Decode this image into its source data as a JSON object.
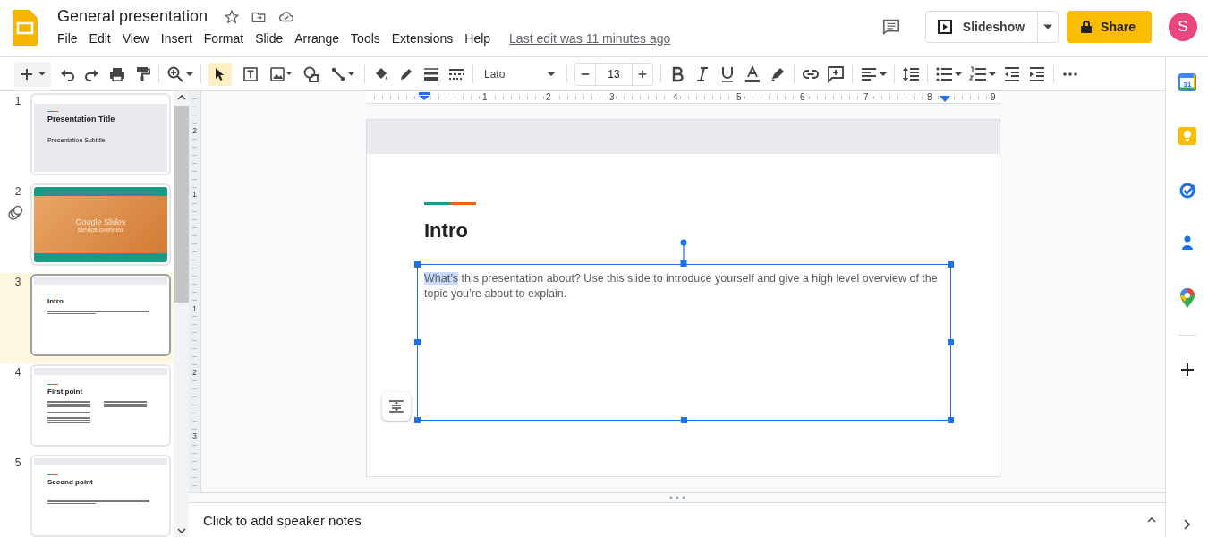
{
  "document": {
    "title": "General presentation",
    "last_edit": "Last edit was 11 minutes ago"
  },
  "menu": [
    "File",
    "Edit",
    "View",
    "Insert",
    "Format",
    "Slide",
    "Arrange",
    "Tools",
    "Extensions",
    "Help"
  ],
  "header_buttons": {
    "slideshow": "Slideshow",
    "share": "Share",
    "avatar": "S"
  },
  "toolbar": {
    "tools": [
      {
        "selected": true
      },
      {
        "selected": false
      },
      {
        "selected": false
      },
      {
        "selected": false
      },
      {
        "selected": false
      }
    ],
    "font": "Lato",
    "font_size": "13"
  },
  "slides": [
    {
      "number": "1",
      "kind": "title",
      "selected": false,
      "linked": false,
      "title": "Presentation Title",
      "subtitle": "Presentation Subtitle"
    },
    {
      "number": "2",
      "kind": "cover",
      "selected": false,
      "linked": true,
      "title": "Google Slides",
      "subtitle": "service overview"
    },
    {
      "number": "3",
      "kind": "content",
      "selected": true,
      "linked": false,
      "title": "Intro"
    },
    {
      "number": "4",
      "kind": "columns",
      "selected": false,
      "linked": false,
      "title": "First point"
    },
    {
      "number": "5",
      "kind": "content",
      "selected": false,
      "linked": false,
      "title": "Second point"
    }
  ],
  "ruler": {
    "horizontal": [
      "1",
      "2",
      "3",
      "4",
      "5",
      "6",
      "7",
      "8",
      "9"
    ],
    "vertical": [
      "2",
      "1",
      "1",
      "2",
      "3"
    ]
  },
  "current_slide": {
    "title": "Intro",
    "body_selected": "What’s",
    "body_rest": " this presentation about? Use this slide to introduce yourself and give a high level overview of the topic you’re about to explain."
  },
  "speaker_notes": {
    "placeholder": "Click to add speaker notes"
  },
  "side_panel": {
    "calendar_day": "31"
  }
}
